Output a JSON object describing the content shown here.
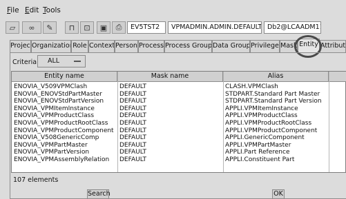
{
  "menu": [
    {
      "first": "F",
      "rest": "ile"
    },
    {
      "first": "E",
      "rest": "dit"
    },
    {
      "first": "T",
      "rest": "ools"
    }
  ],
  "toolbar": {
    "icons": [
      "open-icon",
      "link-icon",
      "edit-icon",
      "unlock-icon",
      "lock-icon",
      "save-icon",
      "print-icon"
    ],
    "server": "EV5TST2",
    "context": "VPMADMIN.ADMIN.DEFAULT",
    "database": "Db2@LCAADM11"
  },
  "tabs": [
    "Project",
    "Organization",
    "Role",
    "Context",
    "Person",
    "Process",
    "Process Group",
    "Data Group",
    "Privilege",
    "Mask",
    "Entity",
    "Attribute"
  ],
  "active_tab": "Entity",
  "criteria": {
    "label": "Criteria:",
    "value": "ALL"
  },
  "table": {
    "columns": [
      "Entity name",
      "Mask name",
      "Alias"
    ],
    "rows": [
      [
        "ENOVIA_V509VPMClash",
        "DEFAULT",
        "CLASH.VPMClash"
      ],
      [
        "ENOVIA_ENOVStdPartMaster",
        "DEFAULT",
        "STDPART.Standard Part Master"
      ],
      [
        "ENOVIA_ENOVStdPartVersion",
        "DEFAULT",
        "STDPART.Standard Part Version"
      ],
      [
        "ENOVIA_VPMItemInstance",
        "DEFAULT",
        "APPLI.VPMItemInstance"
      ],
      [
        "ENOVIA_VPMProductClass",
        "DEFAULT",
        "APPLI.VPMProductClass"
      ],
      [
        "ENOVIA_VPMProductRootClass",
        "DEFAULT",
        "APPLI.VPMProductRootClass"
      ],
      [
        "ENOVIA_VPMProductComponent",
        "DEFAULT",
        "APPLI.VPMProductComponent"
      ],
      [
        "ENOVIA_V508GenericComp",
        "DEFAULT",
        "APPLI.GenericComponent"
      ],
      [
        "ENOVIA_VPMPartMaster",
        "DEFAULT",
        "APPLI.VPMPartMaster"
      ],
      [
        "ENOVIA_VPMPartVersion",
        "DEFAULT",
        "APPLI.Part Reference"
      ],
      [
        "ENOVIA_VPMAssemblyRelation",
        "DEFAULT",
        "APPLI.Constituent Part"
      ]
    ]
  },
  "status": "107 elements",
  "buttons": {
    "search": "Search",
    "ok": "OK"
  }
}
